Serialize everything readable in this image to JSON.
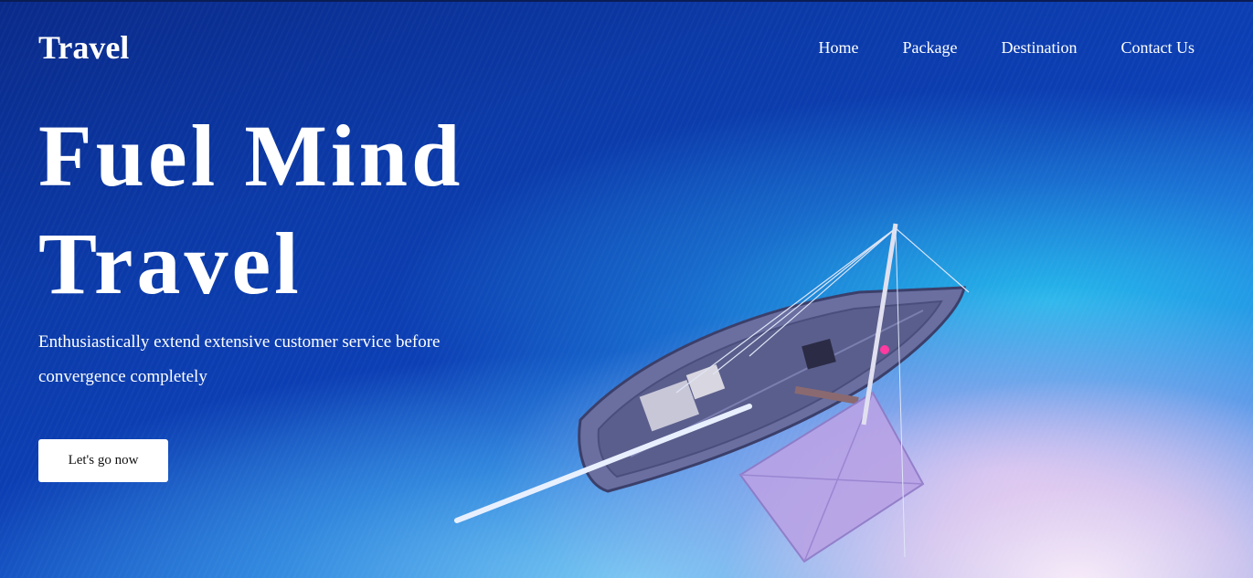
{
  "brand": {
    "logo_text": "Travel"
  },
  "nav": {
    "items": [
      {
        "label": "Home"
      },
      {
        "label": "Package"
      },
      {
        "label": "Destination"
      },
      {
        "label": "Contact Us"
      }
    ]
  },
  "hero": {
    "headline_line1": "Fuel Mind",
    "headline_line2": "Travel",
    "subtext": "Enthusiastically extend extensive customer service before convergence completely",
    "cta_label": "Let's go now",
    "background_image": "aerial-ocean-boat-beach"
  },
  "colors": {
    "deep_ocean": "#0c3fb5",
    "shallow_water": "#2fc0ee",
    "sand": "#f2e2f2",
    "text": "#ffffff",
    "button_bg": "#ffffff",
    "button_text": "#111111"
  }
}
